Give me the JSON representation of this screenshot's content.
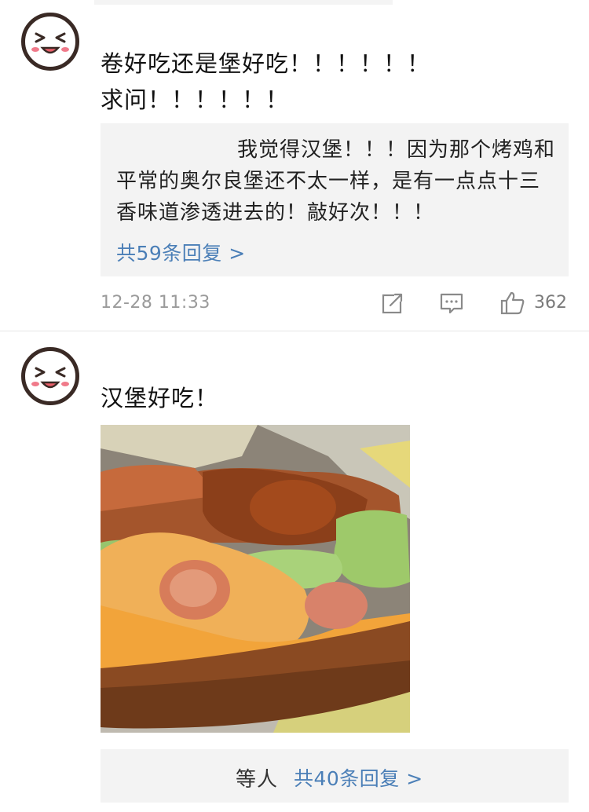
{
  "comments": [
    {
      "avatar_icon": "laughing-face-avatar-icon",
      "text": "卷好吃还是堡好吃！！！！！！求问！！！！！！",
      "reply": {
        "text": "我觉得汉堡！！！因为那个烤鸡和平常的奥尔良堡还不太一样，是有一点点十三香味道渗透进去的！敲好次！！！",
        "count_label": "共59条回复 >"
      },
      "timestamp": "12-28 11:33",
      "actions": {
        "share_icon": "share-icon",
        "comment_icon": "comment-icon",
        "like_icon": "thumbs-up-icon",
        "like_count": "362"
      }
    },
    {
      "avatar_icon": "laughing-face-avatar-icon",
      "text": "汉堡好吃！",
      "photo_icon": "burger-photo",
      "reply": {
        "preview": "等人",
        "count_label": "共40条回复 >"
      }
    }
  ],
  "colors": {
    "link": "#4b7fb7",
    "reply_bg": "#f3f3f3",
    "meta_gray": "#9a9a9a",
    "avatar_blush": "#f07a8a",
    "avatar_outline": "#3a2a25"
  }
}
